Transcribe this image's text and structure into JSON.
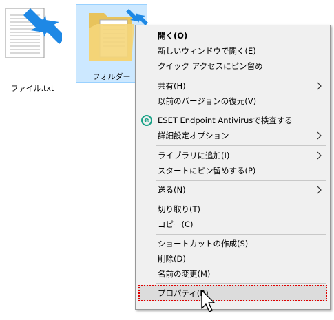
{
  "desktop": {
    "file_label": "ファイル.txt",
    "folder_label": "フォルダー"
  },
  "menu": {
    "items": [
      {
        "label": "開く(O)"
      },
      {
        "label": "新しいウィンドウで開く(E)"
      },
      {
        "label": "クイック アクセスにピン留め"
      },
      {
        "label": "共有(H)"
      },
      {
        "label": "以前のバージョンの復元(V)"
      },
      {
        "label": "ESET Endpoint Antivirusで検査する"
      },
      {
        "label": "詳細設定オプション"
      },
      {
        "label": "ライブラリに追加(I)"
      },
      {
        "label": "スタートにピン留めする(P)"
      },
      {
        "label": "送る(N)"
      },
      {
        "label": "切り取り(T)"
      },
      {
        "label": "コピー(C)"
      },
      {
        "label": "ショートカットの作成(S)"
      },
      {
        "label": "削除(D)"
      },
      {
        "label": "名前の変更(M)"
      },
      {
        "label": "プロパティ(R)"
      }
    ],
    "eset_icon_text": "e"
  },
  "colors": {
    "arrow_blue": "#1e88e5",
    "folder_yellow": "#f5d67a",
    "highlight_red": "#e00000",
    "selection_bg": "#cce8ff"
  }
}
